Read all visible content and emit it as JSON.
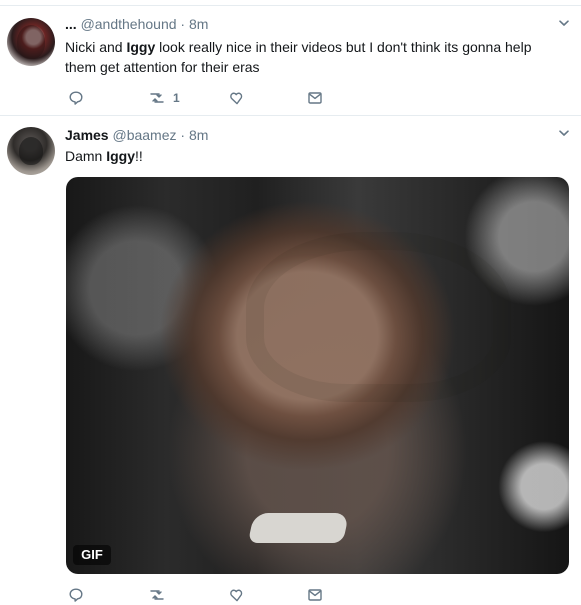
{
  "tweets": [
    {
      "name": "...",
      "handle": "@andthehound",
      "separator": "·",
      "time": "8m",
      "text_parts": [
        "Nicki and ",
        "Iggy",
        " look really nice in their videos but I don't think its gonna help them get attention for their eras"
      ],
      "actions": {
        "reply_icon": "reply-icon",
        "retweet_icon": "retweet-icon",
        "retweet_count": "1",
        "like_icon": "heart-icon",
        "dm_icon": "envelope-icon"
      }
    },
    {
      "name": "James",
      "handle": "@baamez",
      "separator": "·",
      "time": "8m",
      "text_parts": [
        "Damn ",
        "Iggy",
        "!!"
      ],
      "media": {
        "badge": "GIF"
      },
      "actions": {
        "reply_icon": "reply-icon",
        "retweet_icon": "retweet-icon",
        "retweet_count": "",
        "like_icon": "heart-icon",
        "dm_icon": "envelope-icon"
      }
    }
  ],
  "colors": {
    "text": "#14171a",
    "muted": "#657786",
    "divider": "#e6ecf0"
  }
}
